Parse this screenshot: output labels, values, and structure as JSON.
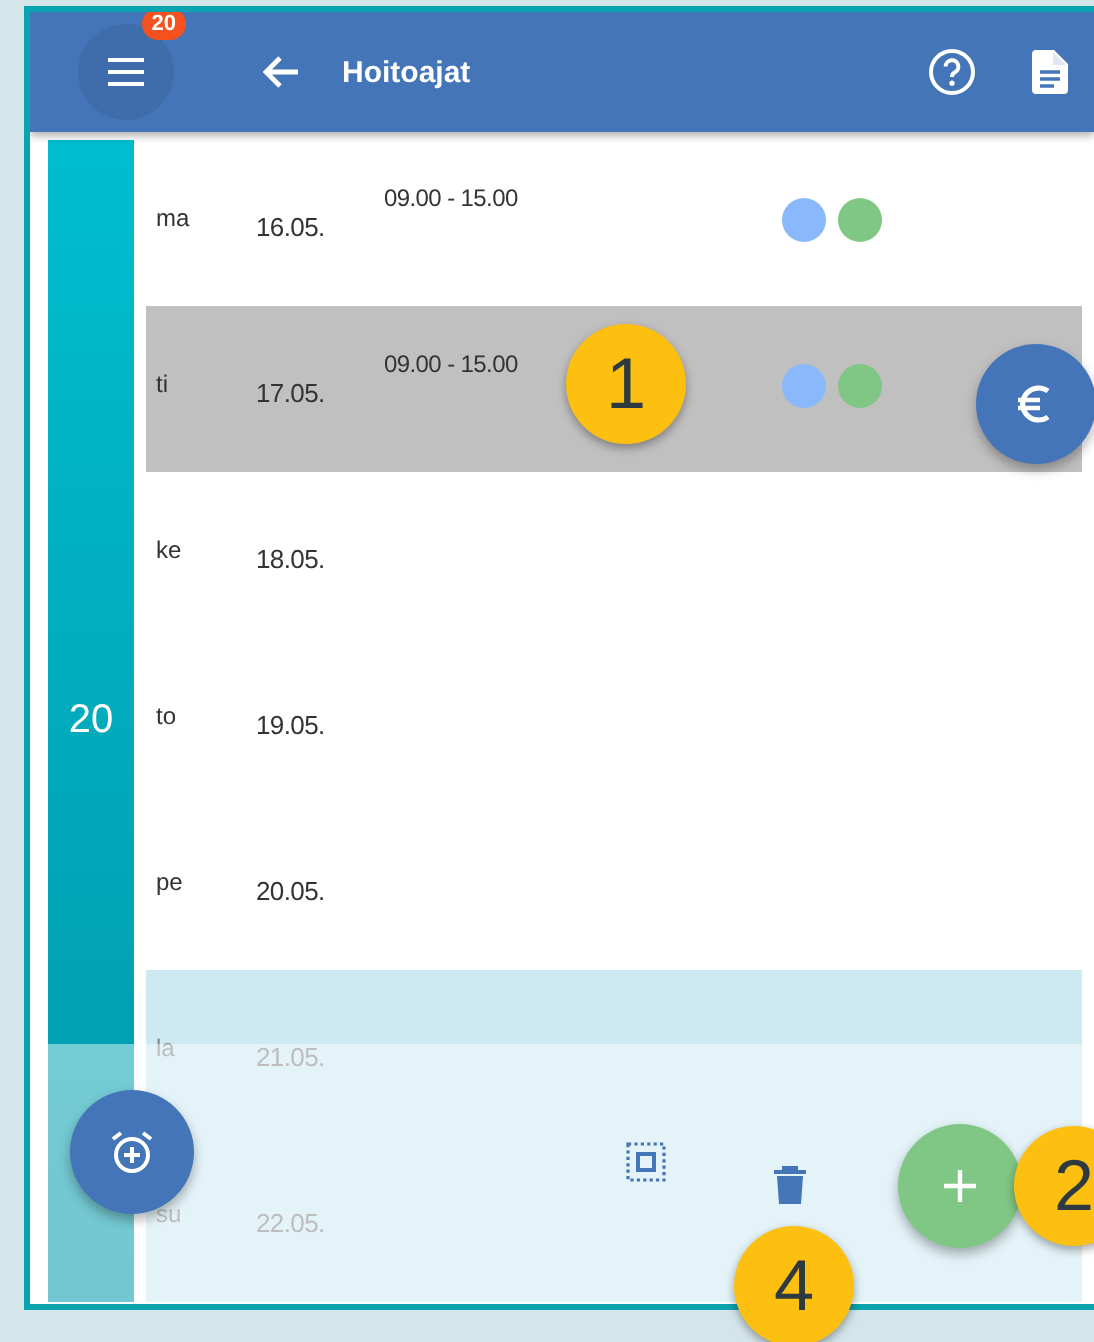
{
  "header": {
    "menu_badge": "20",
    "title": "Hoitoajat"
  },
  "week": {
    "number": "20"
  },
  "days": [
    {
      "day": "ma",
      "date": "16.05.",
      "time": "09.00 - 15.00",
      "markers": [
        {
          "color": "#8ab8fc"
        },
        {
          "color": "#80c684"
        }
      ],
      "selected": false,
      "weekend": false
    },
    {
      "day": "ti",
      "date": "17.05.",
      "time": "09.00 - 15.00",
      "markers": [
        {
          "color": "#8ab8fc"
        },
        {
          "color": "#80c684"
        }
      ],
      "selected": true,
      "weekend": false
    },
    {
      "day": "ke",
      "date": "18.05.",
      "selected": false,
      "weekend": false
    },
    {
      "day": "to",
      "date": "19.05.",
      "selected": false,
      "weekend": false
    },
    {
      "day": "pe",
      "date": "20.05.",
      "selected": false,
      "weekend": false
    },
    {
      "day": "la",
      "date": "21.05.",
      "selected": false,
      "weekend": true
    },
    {
      "day": "su",
      "date": "22.05.",
      "selected": false,
      "weekend": true
    }
  ],
  "callouts": [
    {
      "label": "1"
    },
    {
      "label": "2"
    },
    {
      "label": "4"
    }
  ]
}
